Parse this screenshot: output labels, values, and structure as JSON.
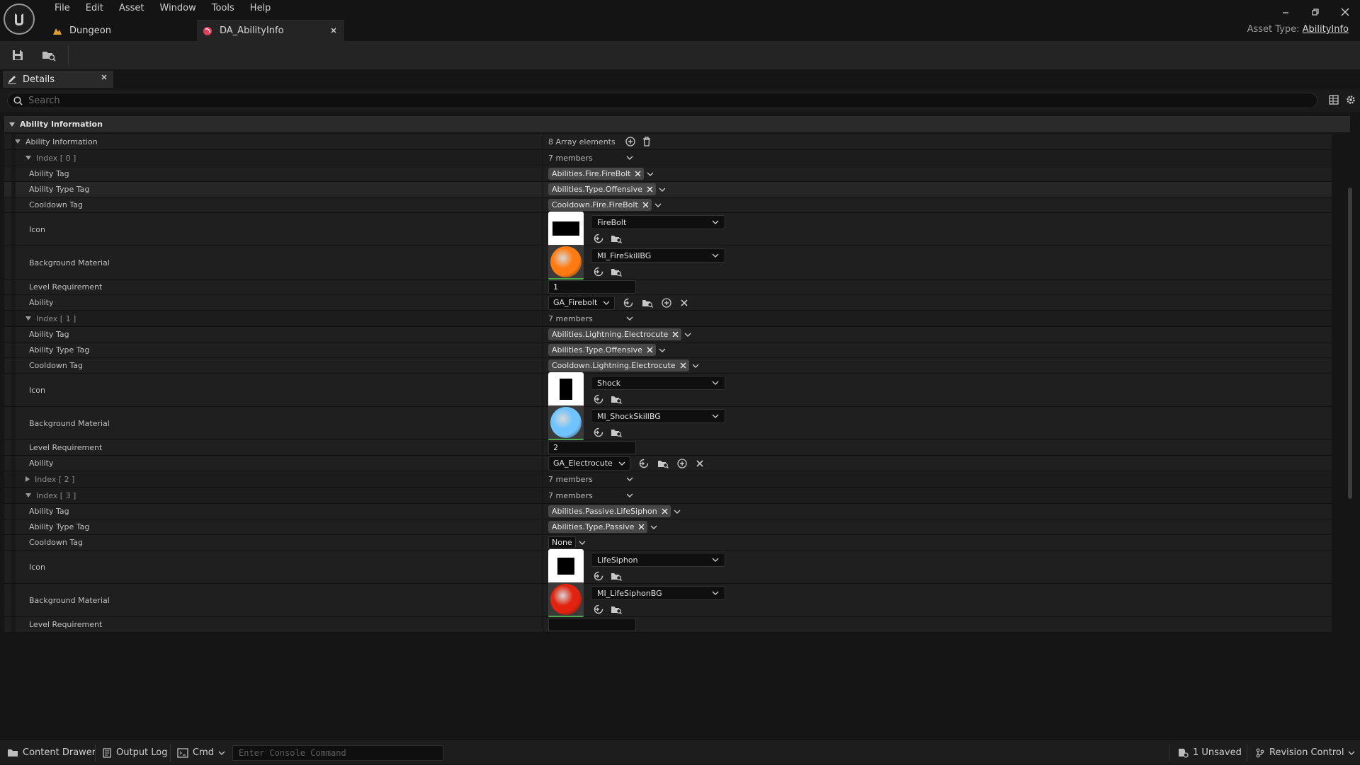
{
  "menu": [
    "File",
    "Edit",
    "Asset",
    "Window",
    "Tools",
    "Help"
  ],
  "tabs": {
    "dungeon": "Dungeon",
    "ability_info": "DA_AbilityInfo"
  },
  "asset_type": {
    "label": "Asset Type:",
    "value": "AbilityInfo"
  },
  "details": {
    "tab_label": "Details",
    "search_placeholder": "Search",
    "category": "Ability Information"
  },
  "property_rows": {
    "array_label": "Ability Information",
    "array_count": "8 Array elements",
    "ability_tag": "Ability Tag",
    "ability_type_tag": "Ability Type Tag",
    "cooldown_tag": "Cooldown Tag",
    "icon": "Icon",
    "background_material": "Background Material",
    "level_requirement": "Level Requirement",
    "ability": "Ability",
    "members": "7 members",
    "none": "None"
  },
  "elements": [
    {
      "index_label": "Index [ 0 ]",
      "ability_tag": "Abilities.Fire.FireBolt",
      "type_tag": "Abilities.Type.Offensive",
      "cooldown_tag": "Cooldown.Fire.FireBolt",
      "icon": "FireBolt",
      "material": "MI_FireSkillBG",
      "level": "1",
      "ability_class": "GA_Firebolt"
    },
    {
      "index_label": "Index [ 1 ]",
      "ability_tag": "Abilities.Lightning.Electrocute",
      "type_tag": "Abilities.Type.Offensive",
      "cooldown_tag": "Cooldown.Lightning.Electrocute",
      "icon": "Shock",
      "material": "MI_ShockSkillBG",
      "level": "2",
      "ability_class": "GA_Electrocute"
    },
    {
      "index_label": "Index [ 2 ]"
    },
    {
      "index_label": "Index [ 3 ]",
      "ability_tag": "Abilities.Passive.LifeSiphon",
      "type_tag": "Abilities.Type.Passive",
      "icon": "LifeSiphon",
      "material": "MI_LifeSiphonBG"
    }
  ],
  "statusbar": {
    "content_drawer": "Content Drawer",
    "output_log": "Output Log",
    "cmd": "Cmd",
    "console_placeholder": "Enter Console Command",
    "unsaved": "1 Unsaved",
    "revision_control": "Revision Control"
  },
  "colors": {
    "fire_orb": "#ff7a10",
    "shock_orb": "#6fc3ff",
    "lifesiphon_orb": "#e0220e",
    "tab_accent": "#e0405a"
  }
}
